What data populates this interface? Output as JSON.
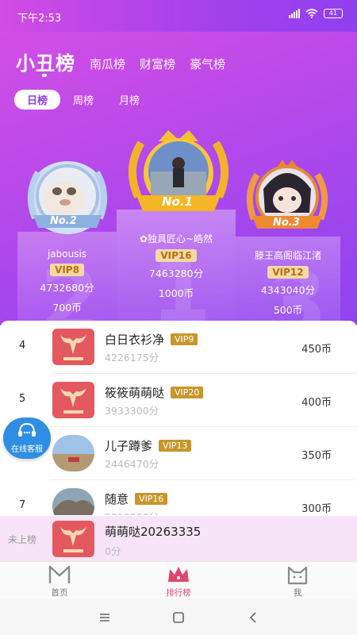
{
  "status": {
    "time": "下午2:53",
    "battery": "41"
  },
  "tabs": {
    "active": "小丑榜",
    "others": [
      "南瓜榜",
      "财富榜",
      "豪气榜"
    ]
  },
  "periods": {
    "day": "日榜",
    "week": "周榜",
    "month": "月榜"
  },
  "podium": [
    {
      "badge": "No.2",
      "name": "jabousis",
      "vip": "VIP8",
      "score": "4732680分",
      "coins": "700币"
    },
    {
      "badge": "No.1",
      "name": "✿独具匠心~皓然",
      "vip": "VIP16",
      "score": "7463280分",
      "coins": "1000币"
    },
    {
      "badge": "No.3",
      "name": "滕王高阁临江渚",
      "vip": "VIP12",
      "score": "4343040分",
      "coins": "500币"
    }
  ],
  "podium_numbers": [
    "2",
    "1",
    "3"
  ],
  "list": [
    {
      "rank": "4",
      "name": "白日衣衫净",
      "vip": "VIP9",
      "score": "4226175分",
      "coins": "450币"
    },
    {
      "rank": "5",
      "name": "筱筱萌萌哒",
      "vip": "VIP20",
      "score": "3933300分",
      "coins": "400币"
    },
    {
      "rank": "",
      "name": "儿子蹲爹",
      "vip": "VIP13",
      "score": "2446470分",
      "coins": "350币"
    },
    {
      "rank": "7",
      "name": "随意",
      "vip": "VIP16",
      "score": "2316960分",
      "coins": "300币"
    }
  ],
  "customer_service": "在线客服",
  "my_rank": {
    "label": "未上榜",
    "name": "萌萌哒20263335",
    "score": "0分"
  },
  "nav": {
    "home": "首页",
    "ranking": "排行榜",
    "me": "我"
  },
  "colors": {
    "accent": "#a146ee",
    "gold": "#c8962a",
    "active_nav": "#e04a7a"
  }
}
